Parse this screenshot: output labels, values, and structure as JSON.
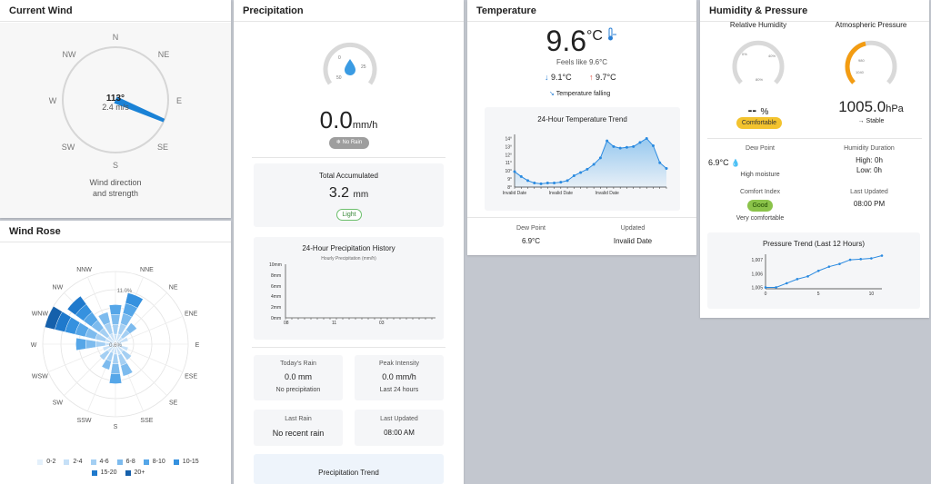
{
  "current_wind": {
    "title": "Current Wind",
    "directions": [
      "N",
      "NE",
      "E",
      "SE",
      "S",
      "SW",
      "W",
      "NW"
    ],
    "degrees": "113°",
    "speed": "2.4 m/s",
    "caption_line1": "Wind direction",
    "caption_line2": "and strength",
    "direction_value": 113
  },
  "wind_rose": {
    "title": "Wind Rose",
    "directions": [
      "N",
      "NNE",
      "NE",
      "ENE",
      "E",
      "ESE",
      "SE",
      "SSE",
      "S",
      "SSW",
      "SW",
      "WSW",
      "W",
      "WNW",
      "NW",
      "NNW"
    ],
    "ring_label": "11.0%",
    "center_label": "0.6%",
    "legend": [
      {
        "label": "0-2",
        "color": "#e3f0fb"
      },
      {
        "label": "2-4",
        "color": "#c6e0f7"
      },
      {
        "label": "4-6",
        "color": "#a4cff3"
      },
      {
        "label": "6-8",
        "color": "#7dbbee"
      },
      {
        "label": "8-10",
        "color": "#55a6e8"
      },
      {
        "label": "10-15",
        "color": "#3591df"
      },
      {
        "label": "15-20",
        "color": "#1f79cc"
      },
      {
        "label": "20+",
        "color": "#1560ab"
      }
    ],
    "petals": [
      {
        "dir": "N",
        "value": 6
      },
      {
        "dir": "NNE",
        "value": 8
      },
      {
        "dir": "NE",
        "value": 4
      },
      {
        "dir": "ENE",
        "value": 2
      },
      {
        "dir": "E",
        "value": 1
      },
      {
        "dir": "ESE",
        "value": 2
      },
      {
        "dir": "SE",
        "value": 3
      },
      {
        "dir": "SSE",
        "value": 5
      },
      {
        "dir": "S",
        "value": 6
      },
      {
        "dir": "SSW",
        "value": 4
      },
      {
        "dir": "SW",
        "value": 3
      },
      {
        "dir": "WSW",
        "value": 2
      },
      {
        "dir": "W",
        "value": 6
      },
      {
        "dir": "WNW",
        "value": 11
      },
      {
        "dir": "NW",
        "value": 9
      },
      {
        "dir": "NNW",
        "value": 5
      }
    ]
  },
  "precipitation": {
    "title": "Precipitation",
    "gauge_ticks": [
      "0",
      "25",
      "50"
    ],
    "rate_value": "0.0",
    "rate_unit": "mm/h",
    "status_badge": "No Rain",
    "total_label": "Total Accumulated",
    "total_value": "3.2",
    "total_unit": "mm",
    "intensity_badge": "Light",
    "history_title": "24-Hour Precipitation History",
    "history_series": "Hourly Precipitation (mm/h)",
    "history_yticks": [
      "10mm",
      "8mm",
      "6mm",
      "4mm",
      "2mm",
      "0mm"
    ],
    "history_xticks": [
      "08",
      "11",
      "03"
    ],
    "todays_rain_label": "Today's Rain",
    "todays_rain_value": "0.0 mm",
    "todays_rain_note": "No precipitation",
    "peak_label": "Peak Intensity",
    "peak_value": "0.0 mm/h",
    "peak_note": "Last 24 hours",
    "last_rain_label": "Last Rain",
    "last_rain_value": "No recent rain",
    "last_updated_label": "Last Updated",
    "last_updated_value": "08:00 AM",
    "trend_title": "Precipitation Trend"
  },
  "temperature": {
    "title": "Temperature",
    "value": "9.6",
    "unit": "°C",
    "feels_like": "Feels like 9.6°C",
    "min": "9.1°C",
    "max": "9.7°C",
    "trend_text": "Temperature falling",
    "chart_title": "24-Hour Temperature Trend",
    "dew_point_label": "Dew Point",
    "dew_point_value": "6.9°C",
    "updated_label": "Updated",
    "updated_value": "Invalid Date"
  },
  "humidity": {
    "title": "Humidity & Pressure",
    "humidity_label": "Relative Humidity",
    "humidity_value": "--",
    "humidity_unit": "%",
    "humidity_ticks": [
      "0%",
      "40%",
      "80%"
    ],
    "comfort_badge": "Comfortable",
    "pressure_label": "Atmospheric Pressure",
    "pressure_value": "1005.0",
    "pressure_unit": "hPa",
    "pressure_ticks": [
      "980",
      "1040"
    ],
    "pressure_trend": "→ Stable",
    "dew_point_label": "Dew Point",
    "dew_point_value": "6.9°C",
    "dew_point_note": "High moisture",
    "duration_label": "Humidity Duration",
    "duration_high": "High: 0h",
    "duration_low": "Low: 0h",
    "comfort_index_label": "Comfort Index",
    "comfort_index_value": "Good",
    "comfort_index_note": "Very comfortable",
    "last_updated_label": "Last Updated",
    "last_updated_value": "08:00 PM",
    "pressure_chart_title": "Pressure Trend (Last 12 Hours)"
  },
  "chart_data": [
    {
      "type": "area",
      "title": "24-Hour Temperature Trend",
      "ylabel": "",
      "yticks": [
        "14°",
        "13°",
        "12°",
        "11°",
        "10°",
        "9°",
        "8°"
      ],
      "ylim": [
        8,
        14.5
      ],
      "x_ticks": [
        "Invalid Date",
        "Invalid Date",
        "Invalid Date"
      ],
      "values": [
        9.9,
        9.3,
        8.8,
        8.5,
        8.4,
        8.5,
        8.5,
        8.6,
        8.8,
        9.4,
        9.8,
        10.2,
        10.8,
        11.6,
        13.7,
        13.0,
        12.8,
        12.9,
        13.0,
        13.5,
        14.0,
        13.1,
        11.0,
        10.3
      ]
    },
    {
      "type": "line",
      "title": "Pressure Trend (Last 12 Hours)",
      "x": [
        0,
        1,
        2,
        3,
        4,
        5,
        6,
        7,
        8,
        9,
        10,
        11
      ],
      "xticks": [
        "0",
        "5",
        "10"
      ],
      "yticks": [
        "1,007",
        "1,006",
        "1,005"
      ],
      "ylim": [
        1004.9,
        1007.4
      ],
      "values": [
        1005.0,
        1005.0,
        1005.3,
        1005.6,
        1005.8,
        1006.2,
        1006.5,
        1006.7,
        1007.0,
        1007.05,
        1007.1,
        1007.3
      ]
    }
  ]
}
